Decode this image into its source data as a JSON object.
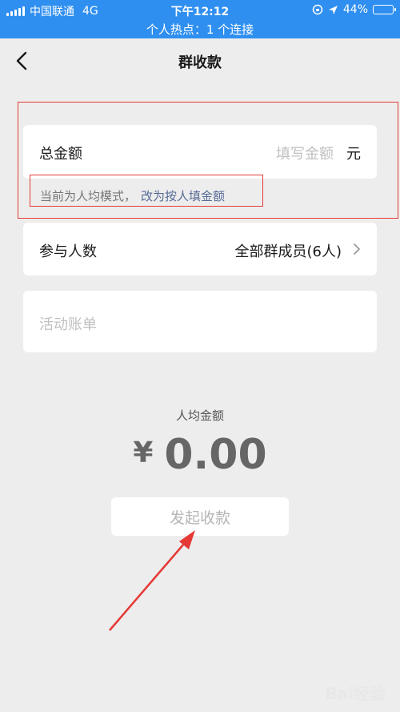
{
  "status_bar": {
    "carrier": "中国联通",
    "network": "4G",
    "time": "下午12:12",
    "battery": "44%",
    "battery_level": 0.44,
    "hotspot": "个人热点：1 个连接"
  },
  "nav": {
    "title": "群收款"
  },
  "amount": {
    "label": "总金额",
    "placeholder": "填写金额",
    "unit": "元"
  },
  "mode_hint": {
    "text": "当前为人均模式，",
    "link": "改为按人填金额"
  },
  "participants": {
    "label": "参与人数",
    "value": "全部群成员(6人)"
  },
  "bill": {
    "placeholder": "活动账单"
  },
  "average": {
    "label": "人均金额",
    "currency": "¥",
    "amount": "0.00"
  },
  "submit": {
    "label": "发起收款"
  },
  "watermark": "Bai经验",
  "colors": {
    "status_bar": "#2f8ff0",
    "link": "#576b95",
    "annotation": "#e53935"
  }
}
